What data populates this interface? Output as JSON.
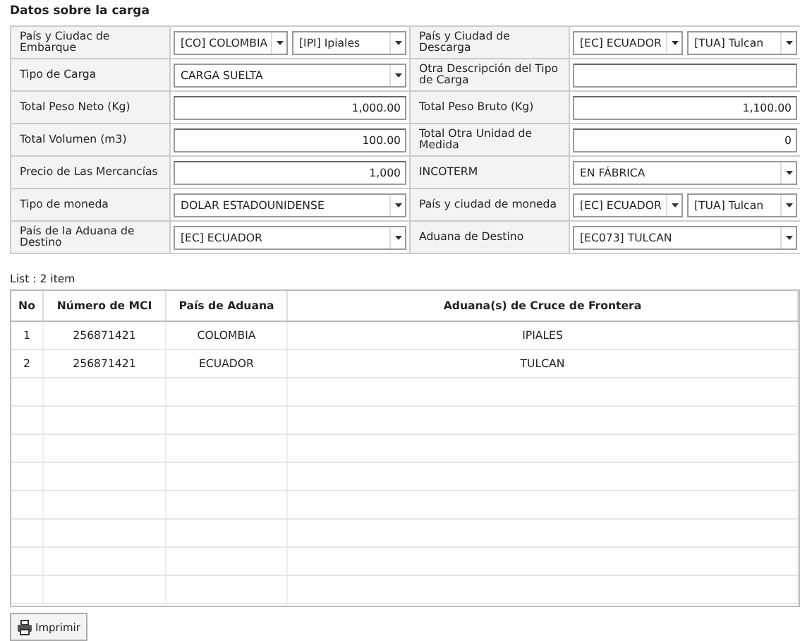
{
  "section_title": "Datos sobre la carga",
  "form_rows": [
    {
      "left": {
        "label": "País y Ciudac de Embarque",
        "kind": "pair",
        "values": [
          "[CO] COLOMBIA",
          "[IPI] Ipiales"
        ]
      },
      "right": {
        "label": "País y Ciudad de Descarga",
        "kind": "pair",
        "values": [
          "[EC] ECUADOR",
          "[TUA] Tulcan"
        ]
      }
    },
    {
      "left": {
        "label": "Tipo de Carga",
        "kind": "select",
        "value": "CARGA SUELTA"
      },
      "right": {
        "label": "Otra Descripción del Tipo de Carga",
        "kind": "input"
      }
    },
    {
      "left": {
        "label": "Total Peso Neto (Kg)",
        "kind": "number",
        "value": "1,000.00"
      },
      "right": {
        "label": "Total Peso Bruto (Kg)",
        "kind": "number",
        "value": "1,100.00"
      }
    },
    {
      "left": {
        "label": "Total Volumen (m3)",
        "kind": "number",
        "value": "100.00"
      },
      "right": {
        "label": "Total Otra Unidad de Medida",
        "kind": "number",
        "value": "0"
      }
    },
    {
      "left": {
        "label": "Precio de Las Mercancías",
        "kind": "number",
        "value": "1,000"
      },
      "right": {
        "label": "INCOTERM",
        "kind": "select",
        "value": "EN FÁBRICA"
      }
    },
    {
      "left": {
        "label": "Tipo de moneda",
        "kind": "select",
        "value": "DOLAR ESTADOUNIDENSE"
      },
      "right": {
        "label": "País y ciudad de moneda",
        "kind": "pair",
        "values": [
          "[EC] ECUADOR",
          "[TUA] Tulcan"
        ]
      }
    },
    {
      "left": {
        "label": "País de la Aduana de Destino",
        "kind": "select",
        "value": "[EC] ECUADOR"
      },
      "right": {
        "label": "Aduana de Destino",
        "kind": "select",
        "value": "[EC073] TULCAN"
      }
    }
  ],
  "list_count": "List : 2 item",
  "table": {
    "columns": [
      "No",
      "Número de MCI",
      "País de Aduana",
      "Aduana(s) de Cruce de Frontera"
    ],
    "rows": [
      [
        "1",
        "256871421",
        "COLOMBIA",
        "IPIALES"
      ],
      [
        "2",
        "256871421",
        "ECUADOR",
        "TULCAN"
      ]
    ]
  },
  "print_button": "Imprimir"
}
